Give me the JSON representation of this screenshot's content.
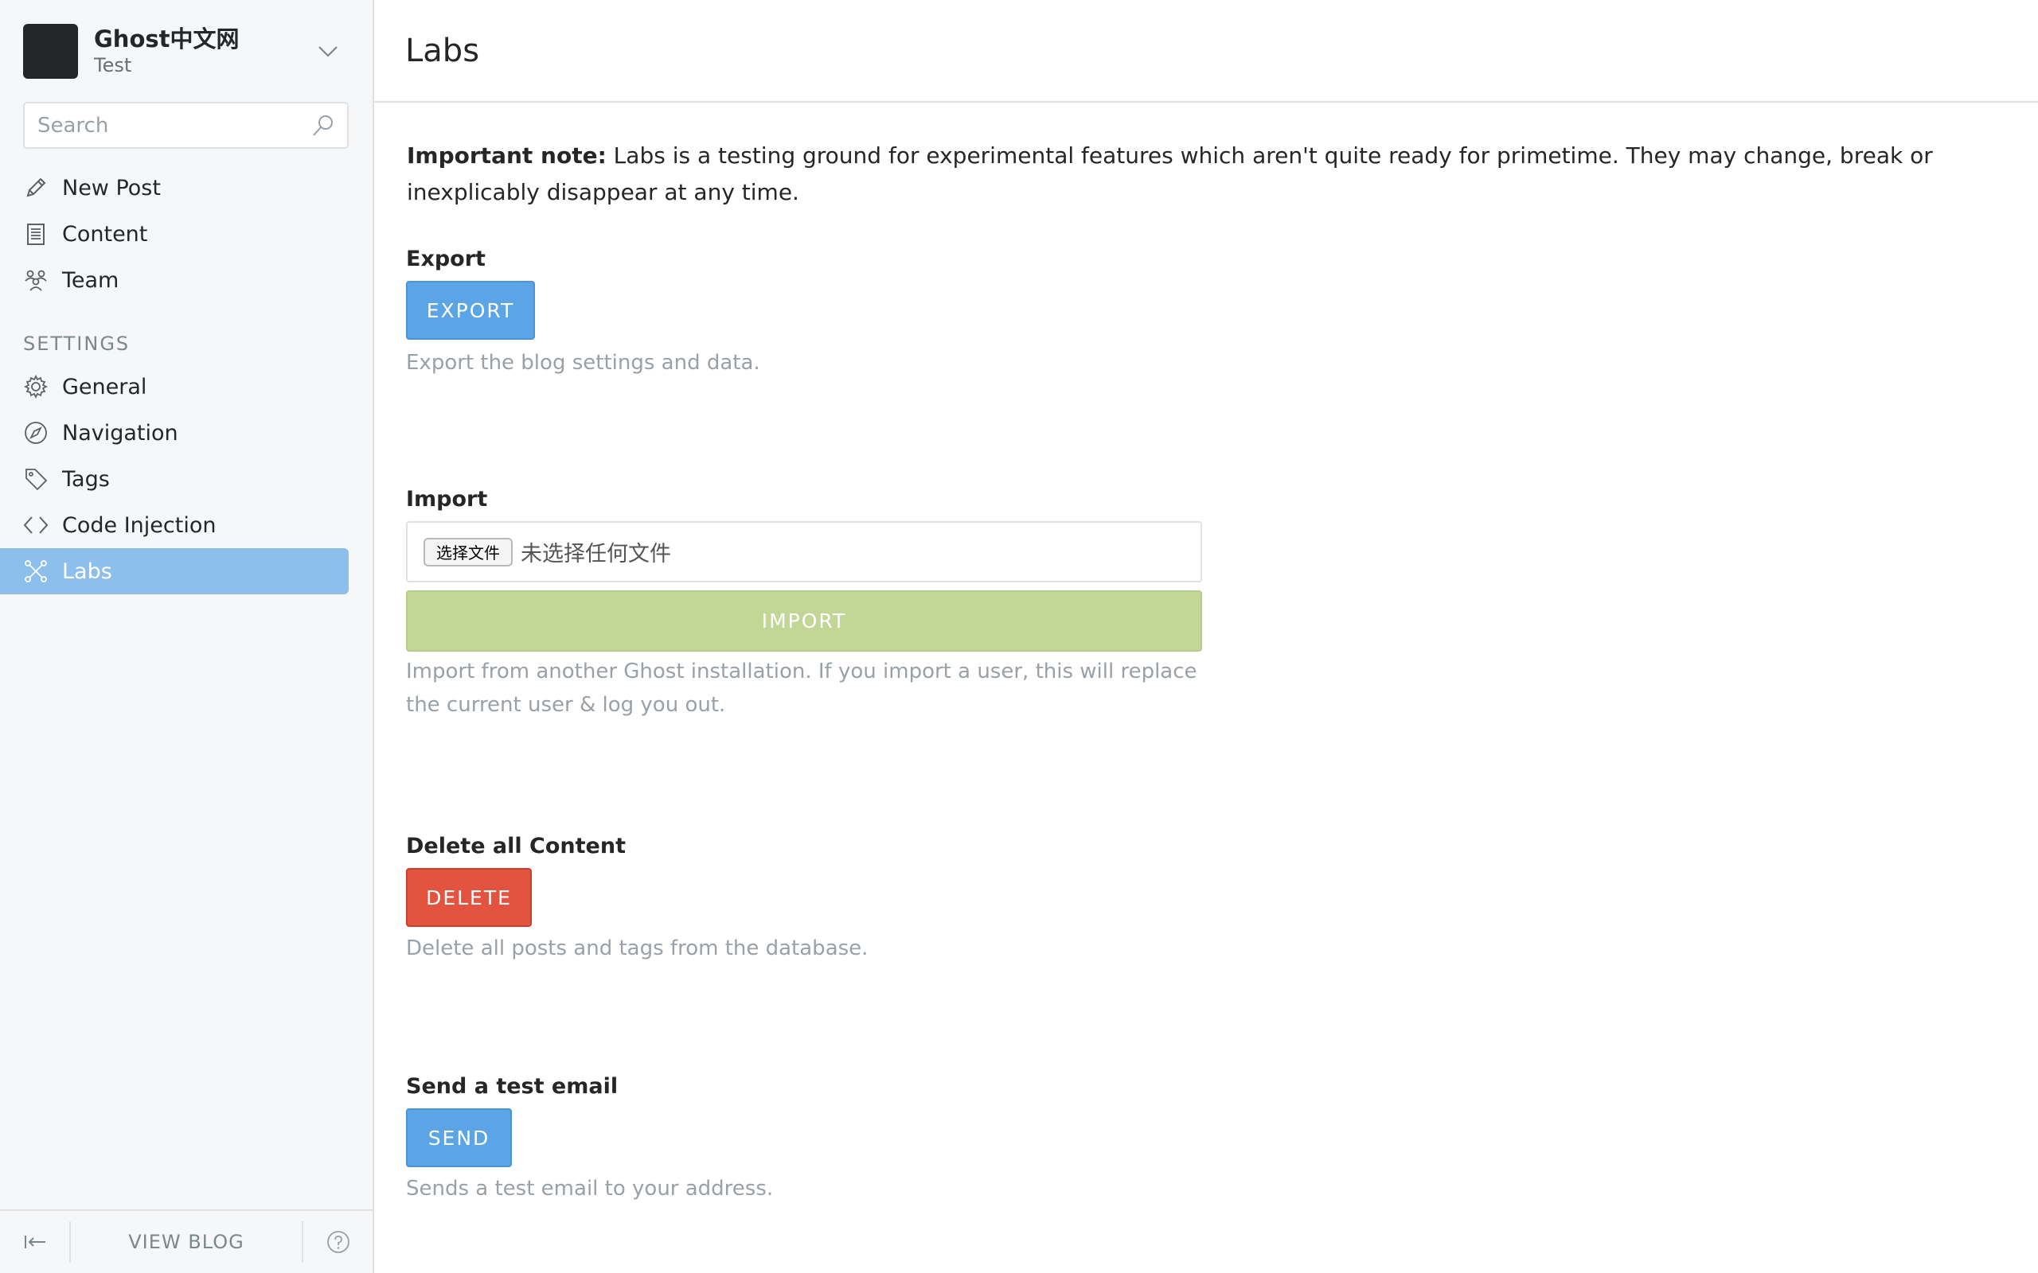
{
  "sidebar": {
    "blog_title": "Ghost中文网",
    "blog_user": "Test",
    "search_placeholder": "Search",
    "main_items": [
      {
        "label": "New Post",
        "icon": "pencil-icon"
      },
      {
        "label": "Content",
        "icon": "content-icon"
      },
      {
        "label": "Team",
        "icon": "team-icon"
      }
    ],
    "settings_heading": "SETTINGS",
    "settings_items": [
      {
        "label": "General",
        "icon": "gear-icon"
      },
      {
        "label": "Navigation",
        "icon": "compass-icon"
      },
      {
        "label": "Tags",
        "icon": "tag-icon"
      },
      {
        "label": "Code Injection",
        "icon": "code-icon"
      },
      {
        "label": "Labs",
        "icon": "labs-icon",
        "active": true
      }
    ],
    "footer": {
      "view_blog": "VIEW BLOG"
    }
  },
  "page": {
    "title": "Labs",
    "note_label": "Important note:",
    "note_text": " Labs is a testing ground for experimental features which aren't quite ready for primetime. They may change, break or inexplicably disappear at any time."
  },
  "export": {
    "label": "Export",
    "button": "EXPORT",
    "help": "Export the blog settings and data."
  },
  "import": {
    "label": "Import",
    "file_button": "选择文件",
    "file_status": "未选择任何文件",
    "button": "IMPORT",
    "help": "Import from another Ghost installation. If you import a user, this will replace the current user & log you out."
  },
  "delete": {
    "label": "Delete all Content",
    "button": "DELETE",
    "help": "Delete all posts and tags from the database."
  },
  "email": {
    "label": "Send a test email",
    "button": "SEND",
    "help": "Sends a test email to your address."
  },
  "colors": {
    "active_nav": "#8dbfed",
    "blue_button": "#5ba4e5",
    "red_button": "#e25440",
    "green_button": "#c2d695"
  }
}
